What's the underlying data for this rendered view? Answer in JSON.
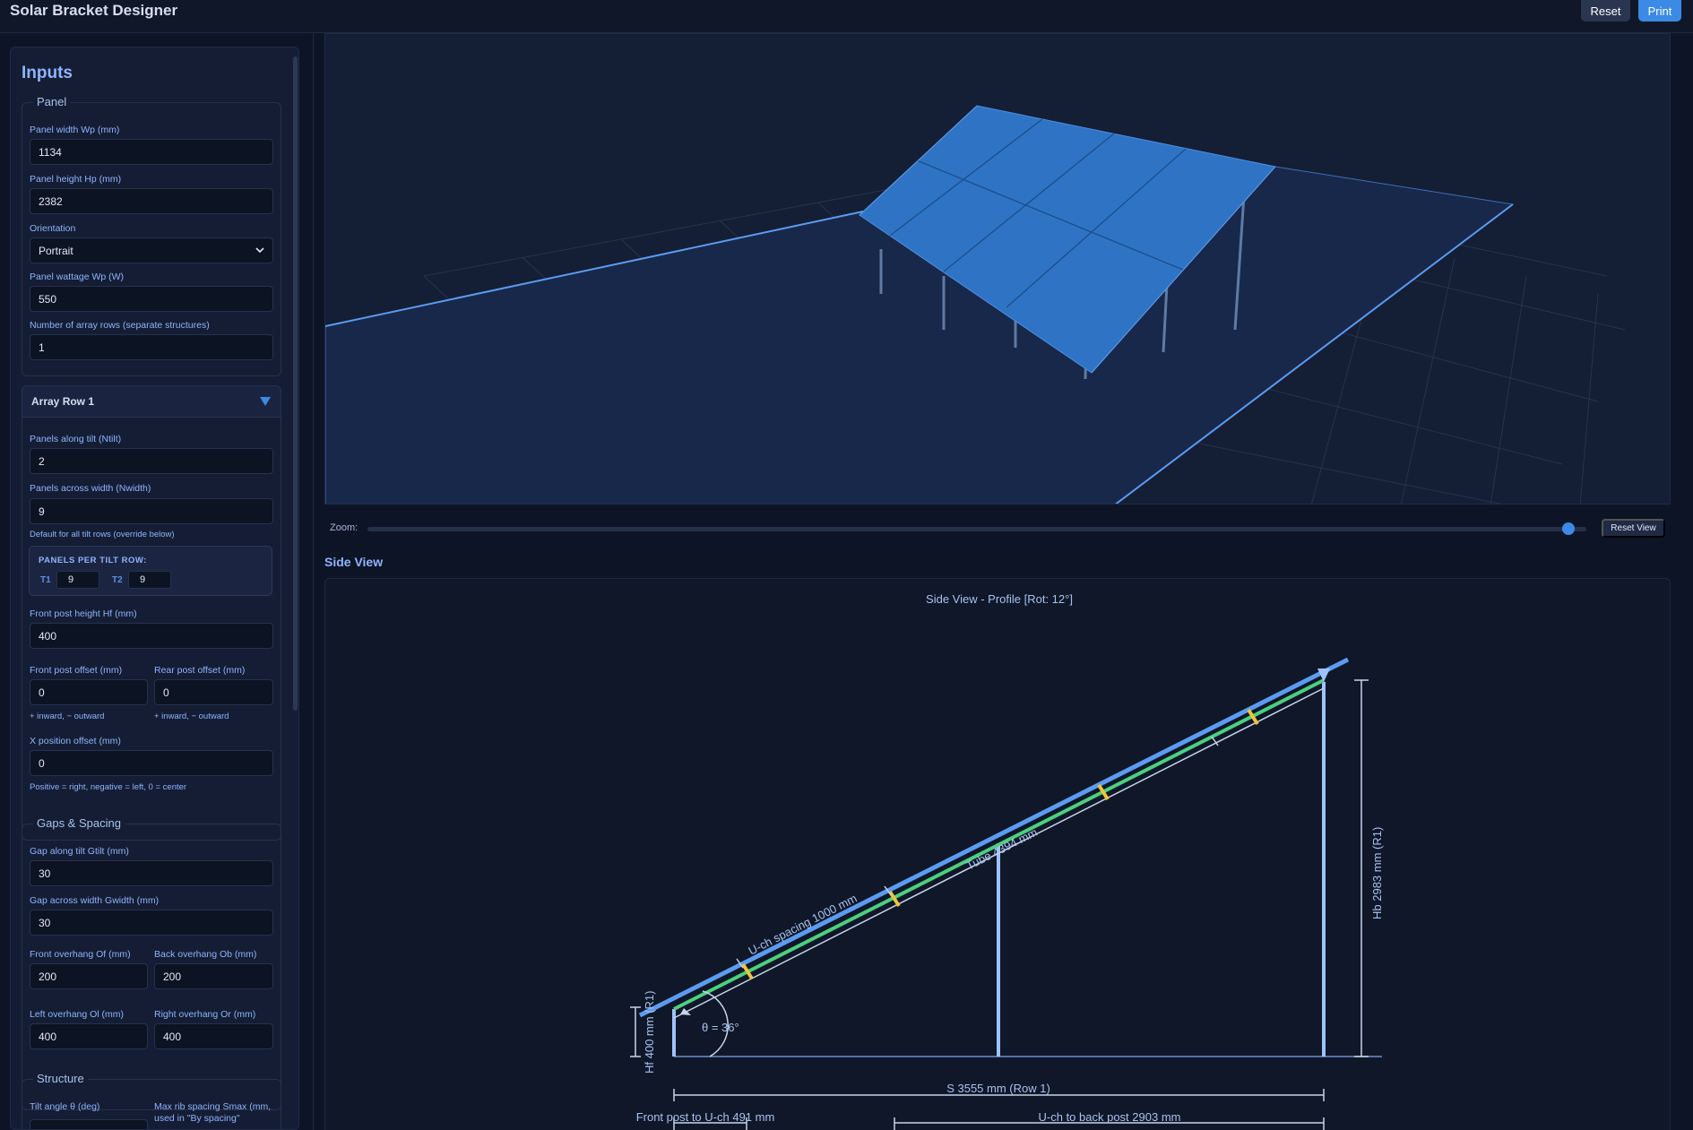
{
  "app": {
    "title": "Solar Bracket Designer",
    "reset_label": "Reset",
    "print_label": "Print"
  },
  "inputs": {
    "heading": "Inputs",
    "panel": {
      "legend": "Panel",
      "width_label": "Panel width Wp (mm)",
      "width_value": "1134",
      "height_label": "Panel height Hp (mm)",
      "height_value": "2382",
      "orientation_label": "Orientation",
      "orientation_value": "Portrait",
      "wattage_label": "Panel wattage Wp (W)",
      "wattage_value": "550",
      "rows_label": "Number of array rows (separate structures)",
      "rows_value": "1"
    },
    "array_row": {
      "title": "Array Row 1",
      "tilt_label": "Panels along tilt (Ntilt)",
      "tilt_value": "2",
      "width_label": "Panels across width (Nwidth)",
      "width_value": "9",
      "width_hint": "Default for all tilt rows (override below)",
      "per_tilt_title": "PANELS PER TILT ROW:",
      "per_tilt": [
        {
          "label": "T1",
          "value": "9"
        },
        {
          "label": "T2",
          "value": "9"
        }
      ],
      "front_post_label": "Front post height Hf (mm)",
      "front_post_value": "400",
      "front_offset_label": "Front post offset (mm)",
      "front_offset_value": "0",
      "front_offset_hint": "+ inward, − outward",
      "rear_offset_label": "Rear post offset (mm)",
      "rear_offset_value": "0",
      "rear_offset_hint": "+ inward, − outward",
      "xpos_label": "X position offset (mm)",
      "xpos_value": "0",
      "xpos_hint": "Positive = right, negative = left, 0 = center"
    },
    "gaps": {
      "legend": "Gaps & Spacing",
      "gtilt_label": "Gap along tilt Gtilt (mm)",
      "gtilt_value": "30",
      "gwidth_label": "Gap across width Gwidth (mm)",
      "gwidth_value": "30",
      "of_label": "Front overhang Of (mm)",
      "of_value": "200",
      "ob_label": "Back overhang Ob (mm)",
      "ob_value": "200",
      "ol_label": "Left overhang Ol (mm)",
      "ol_value": "400",
      "or_label": "Right overhang Or (mm)",
      "or_value": "400"
    },
    "structure": {
      "legend": "Structure",
      "tilt_label": "Tilt angle θ (deg)",
      "smax_label": "Max rib spacing Smax (mm,",
      "smax_label2": "used in \"By spacing\""
    }
  },
  "view3d": {
    "zoom_label": "Zoom:",
    "zoom_level": 0.99,
    "reset_view_label": "Reset View"
  },
  "side_view": {
    "heading": "Side View",
    "title": "Side View - Profile [Rot: 12°]",
    "uch_spacing": "U-ch spacing 1000 mm",
    "tube": "Tube 4394 mm",
    "hb": "Hb 2983 mm (R1)",
    "hf": "Hf 400 mm (R1)",
    "theta": "θ = 36°",
    "span": "S 3555 mm (Row 1)",
    "front_to_uch": "Front post to U-ch 491 mm",
    "uch_to_back": "U-ch to back post 2903 mm",
    "colors": {
      "beam": "#5b9bf0",
      "rail": "#4cd07d",
      "clamp": "#f0c43a",
      "post": "#9dc2ff"
    }
  }
}
